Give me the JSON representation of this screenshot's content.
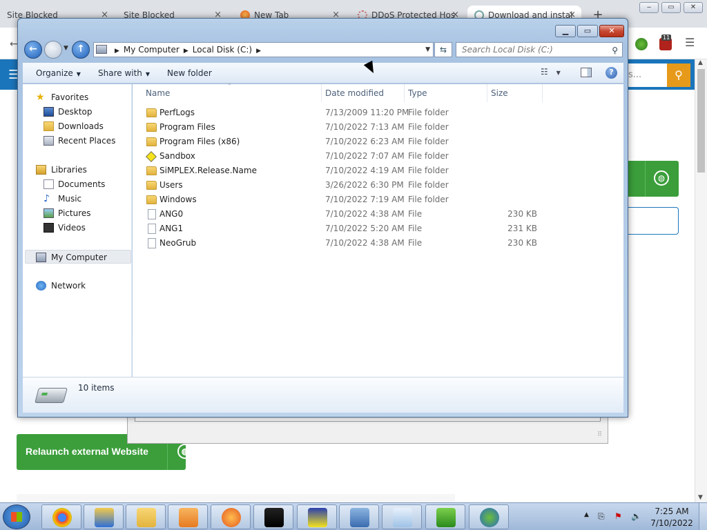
{
  "browser": {
    "tabs": [
      {
        "title": "Site Blocked"
      },
      {
        "title": "Site Blocked"
      },
      {
        "title": "New Tab"
      },
      {
        "title": "DDoS Protected Hos"
      },
      {
        "title": "Download and instal"
      }
    ],
    "close_glyph": "×",
    "new_tab_glyph": "+",
    "window_controls": {
      "minimize": "‒",
      "restore": "▭",
      "close": "✕"
    },
    "extension_badge": "11",
    "search_placeholder_fragment": "s...",
    "relaunch_label": "Relaunch external Website"
  },
  "explorer": {
    "address": {
      "crumbs": [
        "My Computer",
        "Local Disk (C:)"
      ]
    },
    "search_placeholder": "Search Local Disk (C:)",
    "commands": {
      "organize": "Organize",
      "share": "Share with",
      "new_folder": "New folder"
    },
    "columns": {
      "name": "Name",
      "date": "Date modified",
      "type": "Type",
      "size": "Size"
    },
    "nav": {
      "favorites": "Favorites",
      "desktop": "Desktop",
      "downloads": "Downloads",
      "recent": "Recent Places",
      "libraries": "Libraries",
      "documents": "Documents",
      "music": "Music",
      "pictures": "Pictures",
      "videos": "Videos",
      "computer": "My Computer",
      "network": "Network"
    },
    "files": [
      {
        "name": "PerfLogs",
        "date": "7/13/2009 11:20 PM",
        "type": "File folder",
        "size": "",
        "kind": "folder"
      },
      {
        "name": "Program Files",
        "date": "7/10/2022 7:13 AM",
        "type": "File folder",
        "size": "",
        "kind": "folder"
      },
      {
        "name": "Program Files (x86)",
        "date": "7/10/2022 6:23 AM",
        "type": "File folder",
        "size": "",
        "kind": "folder"
      },
      {
        "name": "Sandbox",
        "date": "7/10/2022 7:07 AM",
        "type": "File folder",
        "size": "",
        "kind": "sandbox"
      },
      {
        "name": "SiMPLEX.Release.Name",
        "date": "7/10/2022 4:19 AM",
        "type": "File folder",
        "size": "",
        "kind": "folder"
      },
      {
        "name": "Users",
        "date": "3/26/2022 6:30 PM",
        "type": "File folder",
        "size": "",
        "kind": "folder"
      },
      {
        "name": "Windows",
        "date": "7/10/2022 7:19 AM",
        "type": "File folder",
        "size": "",
        "kind": "folder"
      },
      {
        "name": "ANG0",
        "date": "7/10/2022 4:38 AM",
        "type": "File",
        "size": "230 KB",
        "kind": "file"
      },
      {
        "name": "ANG1",
        "date": "7/10/2022 5:20 AM",
        "type": "File",
        "size": "231 KB",
        "kind": "file"
      },
      {
        "name": "NeoGrub",
        "date": "7/10/2022 4:38 AM",
        "type": "File",
        "size": "230 KB",
        "kind": "file"
      }
    ],
    "item_count": "10 items"
  },
  "taskbar": {
    "clock_time": "7:25 AM",
    "clock_date": "7/10/2022",
    "apps": [
      "chrome-icon",
      "paint-icon",
      "explorer-icon",
      "media-player-icon",
      "firefox-icon",
      "star-app-icon",
      "y-app-icon",
      "network-setup-icon",
      "notepad-icon",
      "cubes-app-icon",
      "globe-download-icon"
    ]
  }
}
